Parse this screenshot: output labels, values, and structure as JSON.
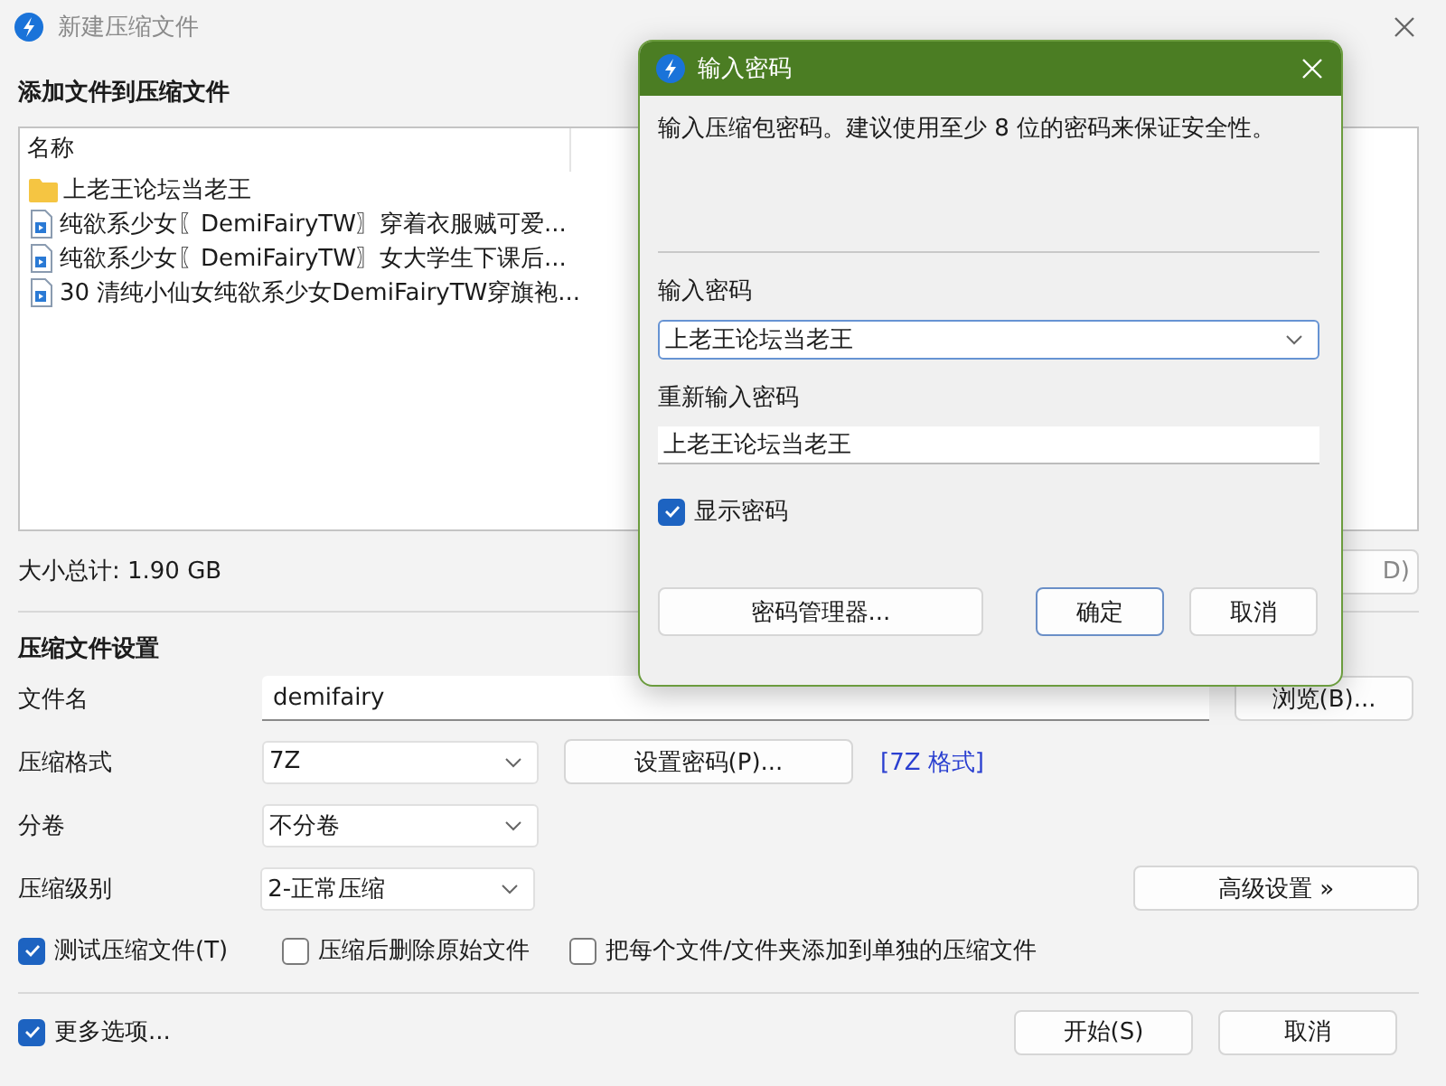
{
  "window": {
    "title": "新建压缩文件"
  },
  "files": {
    "heading": "添加文件到压缩文件",
    "column": "名称",
    "items": [
      {
        "kind": "folder",
        "name": "上老王论坛当老王"
      },
      {
        "kind": "file",
        "name": "纯欲系少女〖DemiFairyTW〗穿着衣服贼可爱..."
      },
      {
        "kind": "file",
        "name": "纯欲系少女〖DemiFairyTW〗女大学生下课后..."
      },
      {
        "kind": "file",
        "name": "30 清纯小仙女纯欲系少女DemiFairyTW穿旗袍..."
      }
    ],
    "total": "大小总计: 1.90 GB",
    "covered_button": "D)"
  },
  "settings": {
    "heading": "压缩文件设置",
    "filename": {
      "label": "文件名",
      "value": "demifairy"
    },
    "browse_button": "浏览(B)...",
    "format": {
      "label": "压缩格式",
      "value": "7Z"
    },
    "password_button": "设置密码(P)...",
    "format_link": "[7Z 格式]",
    "split": {
      "label": "分卷",
      "value": "不分卷"
    },
    "level": {
      "label": "压缩级别",
      "value": "2-正常压缩"
    },
    "advanced_button": "高级设置 »",
    "options": [
      {
        "label": "测试压缩文件(T)",
        "checked": true
      },
      {
        "label": "压缩后删除原始文件",
        "checked": false
      },
      {
        "label": "把每个文件/文件夹添加到单独的压缩文件",
        "checked": false
      }
    ]
  },
  "footer": {
    "more_options": {
      "label": "更多选项...",
      "checked": true
    },
    "buttons": [
      {
        "label": "开始(S)"
      },
      {
        "label": "取消"
      }
    ]
  },
  "dialog": {
    "title": "输入密码",
    "hint": "输入压缩包密码。建议使用至少 8 位的密码来保证安全性。",
    "password": {
      "label": "输入密码",
      "value": "上老王论坛当老王"
    },
    "confirm": {
      "label": "重新输入密码",
      "value": "上老王论坛当老王"
    },
    "show_password": {
      "label": "显示密码",
      "checked": true
    },
    "manager_button": "密码管理器...",
    "buttons": [
      {
        "label": "确定",
        "default": true
      },
      {
        "label": "取消",
        "default": false
      }
    ]
  }
}
